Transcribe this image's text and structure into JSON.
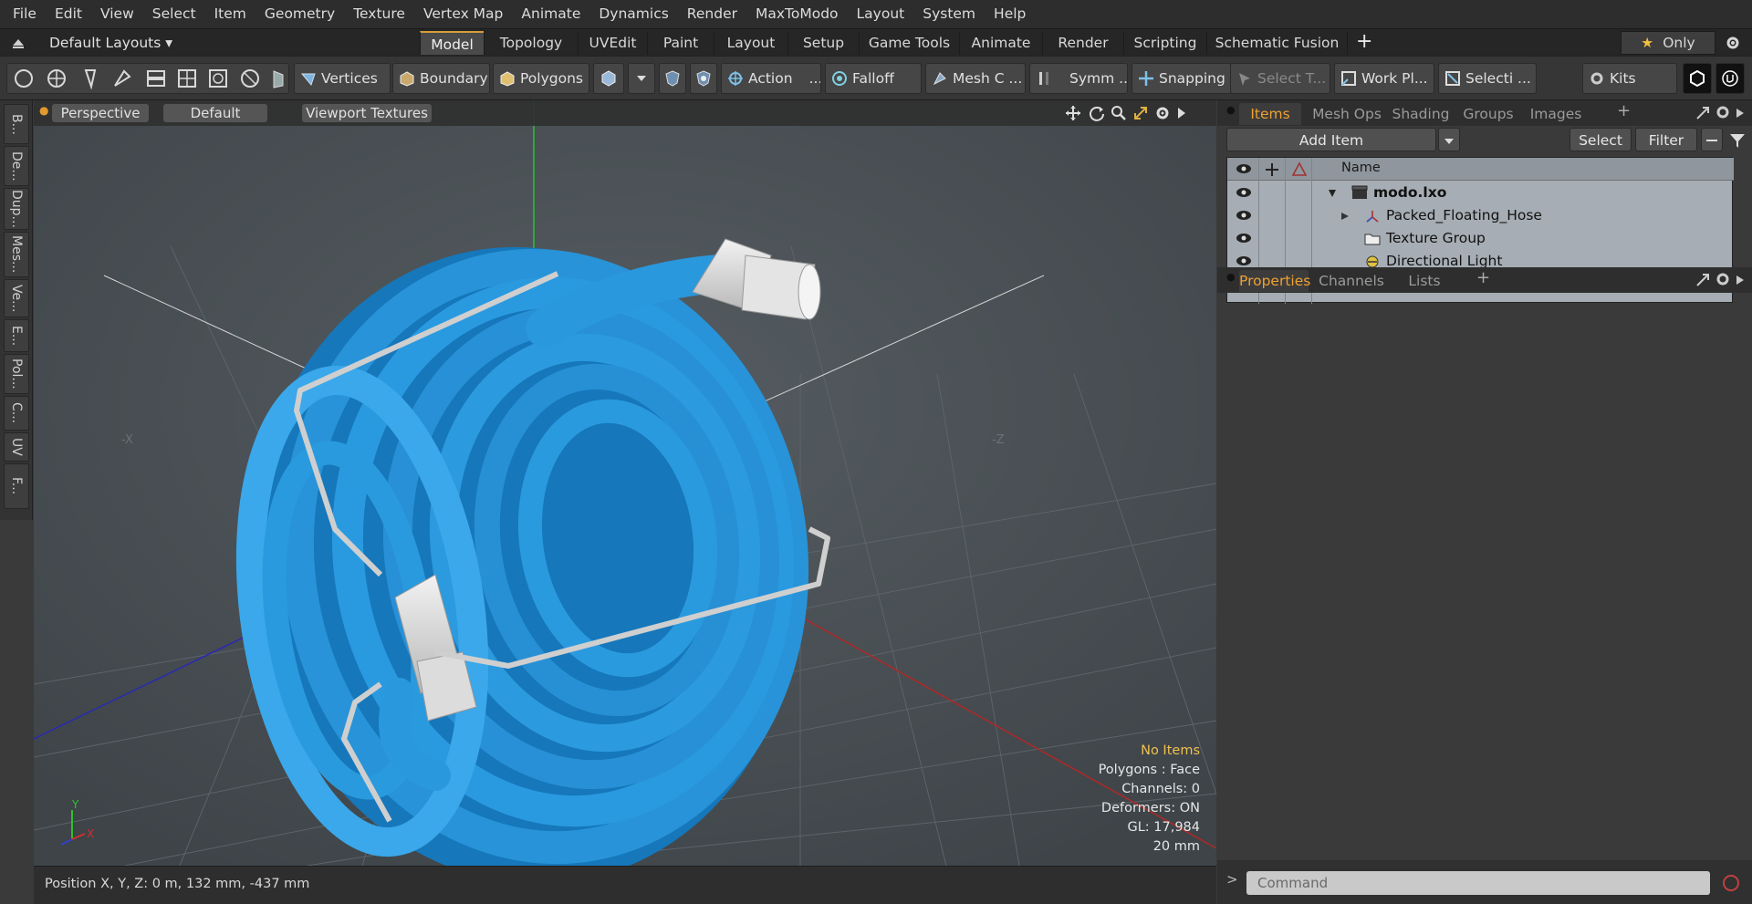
{
  "menu": [
    "File",
    "Edit",
    "View",
    "Select",
    "Item",
    "Geometry",
    "Texture",
    "Vertex Map",
    "Animate",
    "Dynamics",
    "Render",
    "MaxToModo",
    "Layout",
    "System",
    "Help"
  ],
  "layout_menu": "Default Layouts ▾",
  "layout_tabs": [
    "Model",
    "Topology",
    "UVEdit",
    "Paint",
    "Layout",
    "Setup",
    "Game Tools",
    "Animate",
    "Render",
    "Scripting",
    "Schematic Fusion"
  ],
  "only_label": "Only",
  "toolbar": {
    "vertices": "Vertices",
    "boundary": "Boundary",
    "polygons": "Polygons",
    "action": "Action",
    "falloff": "Falloff",
    "mesh": "Mesh C ...",
    "symm": "Symm ...",
    "snapping": "Snapping",
    "select_t": "Select T...",
    "workpl": "Work Pl...",
    "selecti": "Selecti ...",
    "kits": "Kits"
  },
  "left_tabs": [
    "B...",
    "De...",
    "Dup...",
    "Mes...",
    "Ve...",
    "E...",
    "Pol...",
    "C...",
    "UV",
    "F..."
  ],
  "viewport": {
    "perspective": "Perspective",
    "default": "Default",
    "textures": "Viewport Textures",
    "axis_neg_x": "-X",
    "axis_neg_z": "-Z",
    "gizmo_y": "Y",
    "gizmo_x": "X",
    "info_title": "No Items",
    "info_lines": [
      "Polygons : Face",
      "Channels: 0",
      "Deformers: ON",
      "GL: 17,984",
      "20 mm"
    ]
  },
  "status": {
    "position": "Position X, Y, Z:   0 m, 132 mm, -437 mm"
  },
  "items_panel": {
    "tabs": [
      "Items",
      "Mesh Ops",
      "Shading",
      "Groups",
      "Images"
    ],
    "add_item": "Add Item",
    "select": "Select",
    "filter": "Filter",
    "col_name": "Name",
    "tree": [
      {
        "label": "modo.lxo",
        "bold": true
      },
      {
        "label": "Packed_Floating_Hose"
      },
      {
        "label": "Texture Group"
      },
      {
        "label": "Directional Light"
      }
    ]
  },
  "props_panel": {
    "tabs": [
      "Properties",
      "Channels",
      "Lists"
    ]
  },
  "command_placeholder": "Command",
  "colors": {
    "accent": "#d79d3b",
    "hose": "#2a93d6",
    "viewport_bg": "#4b5256"
  }
}
